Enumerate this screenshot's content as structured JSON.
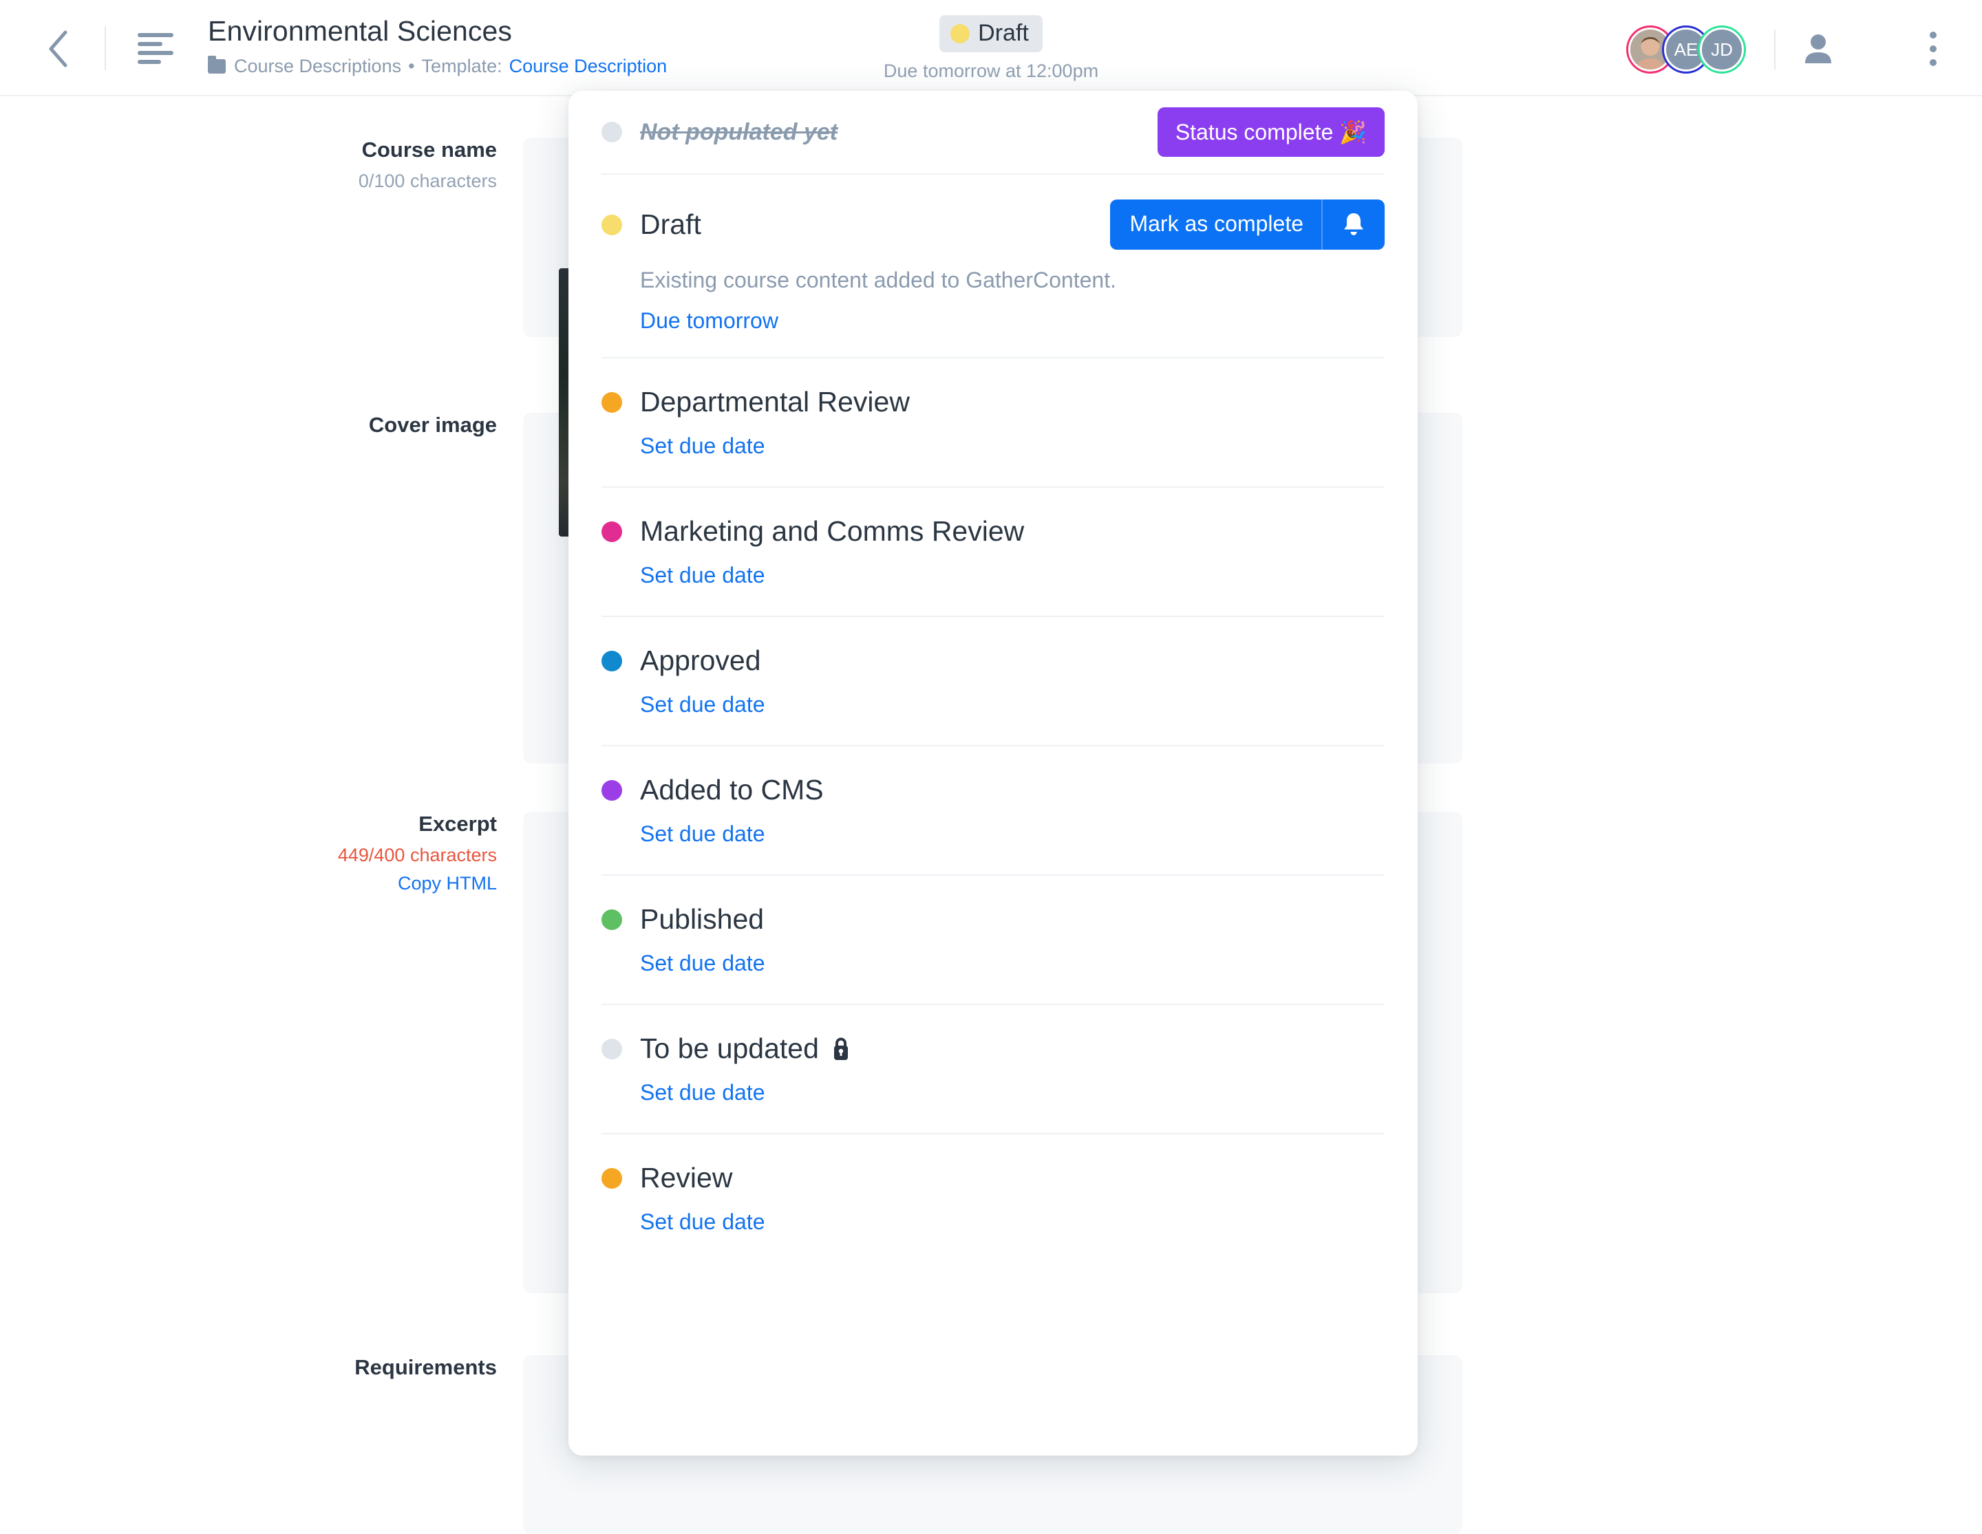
{
  "header": {
    "back_icon": "chevron-left-icon",
    "doc_icon": "document-outline-icon",
    "title": "Environmental Sciences",
    "breadcrumb_folder": "Course Descriptions",
    "breadcrumb_sep": "•",
    "breadcrumb_template_label": "Template:",
    "breadcrumb_template_value": "Course Description",
    "status_chip_label": "Draft",
    "status_chip_color": "#f7dd6b",
    "due_text": "Due tomorrow at 12:00pm",
    "avatars": [
      {
        "name": "photo-avatar",
        "initials": "",
        "ring": "#f4306d"
      },
      {
        "name": "initials-avatar-ae",
        "initials": "AE",
        "ring": "#2a2fd4"
      },
      {
        "name": "initials-avatar-jd",
        "initials": "JD",
        "ring": "#2ee39a"
      }
    ],
    "person_icon": "person-icon",
    "kebab_icon": "vertical-dots-icon"
  },
  "page_fields": [
    {
      "label": "Course name",
      "sub": "0/100 characters",
      "sub_over": false,
      "link": null,
      "ghost": ""
    },
    {
      "label": "Cover image",
      "sub": null,
      "sub_over": false,
      "link": null,
      "ghost": ""
    },
    {
      "label": "Excerpt",
      "sub": "449/400 characters",
      "sub_over": true,
      "link": "Copy HTML",
      "ghost": ""
    },
    {
      "label": "Requirements",
      "sub": null,
      "sub_over": false,
      "link": null,
      "ghost": ""
    }
  ],
  "popup": {
    "not_populated": {
      "label": "Not populated yet",
      "dot_color": "#dfe4ea",
      "button_label": "Status complete 🎉",
      "button_color": "#8b3ef0"
    },
    "current": {
      "name": "Draft",
      "dot_color": "#f7dd6b",
      "button_label": "Mark as complete",
      "button_color": "#0b72f5",
      "bell_icon": "bell-icon",
      "description": "Existing course content added to GatherContent.",
      "due_label": "Due tomorrow"
    },
    "set_due_label": "Set due date",
    "statuses": [
      {
        "name": "Departmental Review",
        "dot_color": "#f5a623",
        "locked": false
      },
      {
        "name": "Marketing and Comms Review",
        "dot_color": "#e12d92",
        "locked": false
      },
      {
        "name": "Approved",
        "dot_color": "#1089ce",
        "locked": false
      },
      {
        "name": "Added to CMS",
        "dot_color": "#9b3ee8",
        "locked": false
      },
      {
        "name": "Published",
        "dot_color": "#5fbf63",
        "locked": false
      },
      {
        "name": "To be updated",
        "dot_color": "#dfe4ea",
        "locked": true
      },
      {
        "name": "Review",
        "dot_color": "#f5a623",
        "locked": false
      }
    ]
  }
}
